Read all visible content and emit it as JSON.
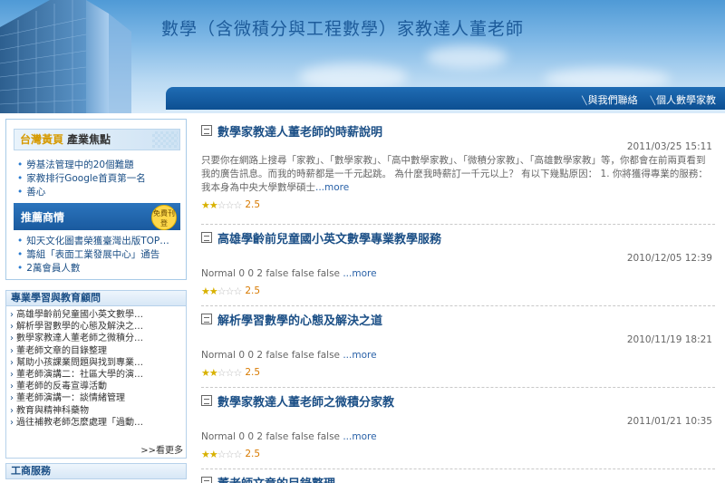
{
  "header": {
    "title": "數學（含微積分與工程數學）家教達人董老師",
    "nav": [
      "與我們聯絡",
      "個人數學家教"
    ]
  },
  "sidebar": {
    "promo": {
      "title_yellow": "台灣黃頁",
      "title_dark": "產業焦點",
      "items": [
        "勞基法管理中的20個難題",
        "家教排行Google首頁第一名",
        "善心"
      ],
      "recommend_label": "推薦商情",
      "badge": "免費刊登",
      "recommend_items": [
        "知天文化圖書榮獲臺灣出版TOP…",
        "籌組「表面工業發展中心」通告",
        "2萬會員人數"
      ]
    },
    "education": {
      "title": "專業學習與教育顧問",
      "items": [
        "高雄學齡前兒童國小英文數學…",
        "解析學習數學的心態及解決之…",
        "數學家教達人董老師之微積分…",
        "董老師文章的目錄整理",
        "幫助小孩課業問題與找到專業…",
        "董老師演講二：社區大學的演…",
        "董老師的反毒宣導活動",
        "董老師演講一：談情緒管理",
        "教育與精神科藥物",
        "過往補教老師怎麼處理「過動…"
      ],
      "more": ">>看更多"
    },
    "business": {
      "title": "工商服務"
    }
  },
  "posts": [
    {
      "title": "數學家教達人董老師的時薪說明",
      "date": "2011/03/25 15:11",
      "body": "只要你在網路上搜尋「家教」、「數學家教」、「高中數學家教」、「微積分家教」、「高雄數學家教」等，你都會在前兩頁看到我的廣告訊息。而我的時薪都是一千元起跳。 為什麼我時薪訂一千元以上？ 有以下幾點原因： 1. 你將獲得專業的服務： 我本身為中央大學數學碩士",
      "more": "...more",
      "rating": "2.5",
      "stars": 2.5
    },
    {
      "title": "高雄學齡前兒童國小英文數學專業教學服務",
      "date": "2010/12/05 12:39",
      "body": "Normal 0 0 2 false false false ",
      "more": "...more",
      "rating": "2.5",
      "stars": 2.5
    },
    {
      "title": "解析學習數學的心態及解決之道",
      "date": "2010/11/19 18:21",
      "body": "Normal 0 0 2 false false false ",
      "more": "...more",
      "rating": "2.5",
      "stars": 2.5
    },
    {
      "title": "數學家教達人董老師之微積分家教",
      "date": "2011/01/21 10:35",
      "body": "Normal 0 0 2 false false false ",
      "more": "...more",
      "rating": "2.5",
      "stars": 2.5
    },
    {
      "title": "董老師文章的目錄整理",
      "date": "",
      "body": "",
      "more": "",
      "rating": "",
      "stars": 0
    }
  ]
}
